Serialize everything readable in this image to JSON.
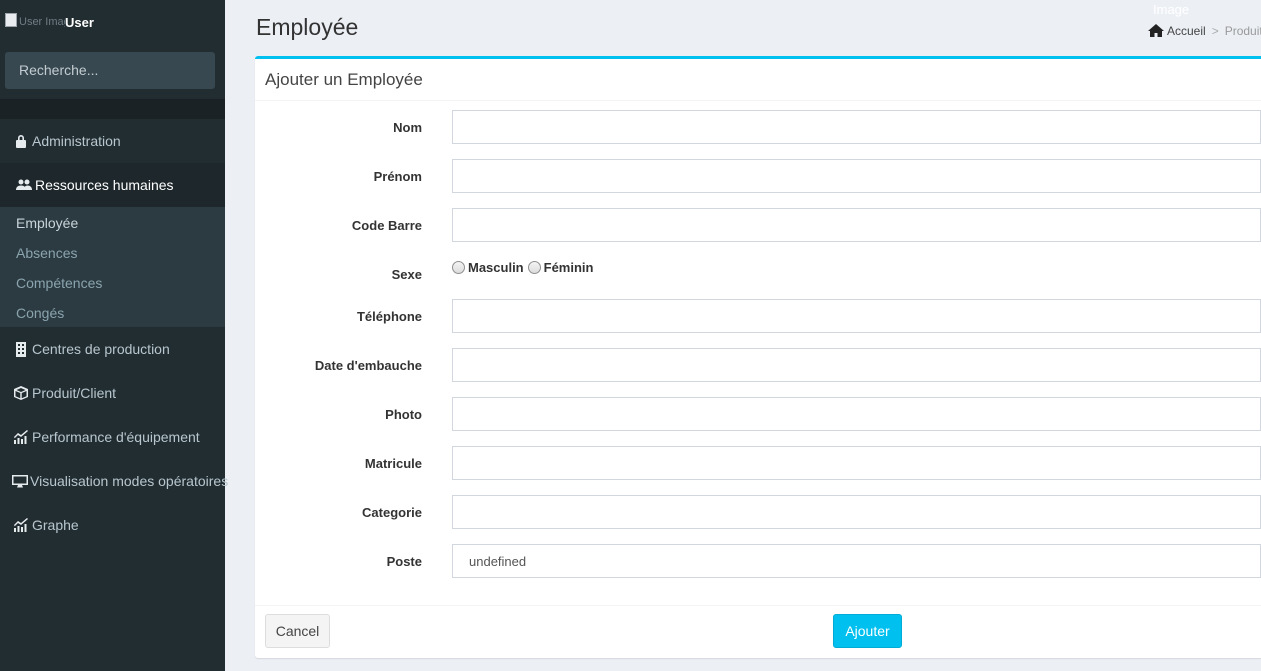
{
  "sidebar": {
    "user_image_alt": "User Image",
    "user_name": "User",
    "search_placeholder": "Recherche...",
    "menu": [
      {
        "label": "Administration",
        "icon": "lock-icon"
      },
      {
        "label": "Ressources humaines",
        "icon": "users-icon"
      },
      {
        "label": "Centres de production",
        "icon": "building-icon"
      },
      {
        "label": "Produit/Client",
        "icon": "cube-icon"
      },
      {
        "label": "Performance d'équipement",
        "icon": "chart-icon"
      },
      {
        "label": "Visualisation modes opératoires",
        "icon": "desktop-icon"
      },
      {
        "label": "Graphe",
        "icon": "chart-icon"
      }
    ],
    "submenu": [
      "Employée",
      "Absences",
      "Compétences",
      "Congés"
    ]
  },
  "header": {
    "title": "Employée",
    "image_label": "Image",
    "breadcrumb": [
      "Accueil",
      "Produit"
    ]
  },
  "form": {
    "title": "Ajouter un Employée",
    "labels": {
      "nom": "Nom",
      "prenom": "Prénom",
      "code_barre": "Code Barre",
      "sexe": "Sexe",
      "telephone": "Téléphone",
      "date_embauche": "Date d'embauche",
      "photo": "Photo",
      "matricule": "Matricule",
      "categorie": "Categorie",
      "poste": "Poste"
    },
    "values": {
      "poste": "undefined"
    },
    "sexe_options": [
      "Masculin",
      "Féminin"
    ],
    "cancel_label": "Cancel",
    "submit_label": "Ajouter"
  },
  "colors": {
    "sidebar_bg": "#222d32",
    "accent": "#00c0ef",
    "content_bg": "#ecf0f5"
  }
}
